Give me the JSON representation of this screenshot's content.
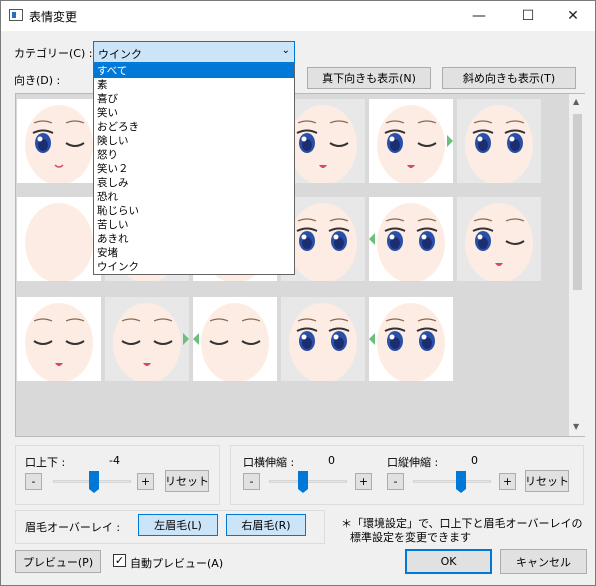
{
  "window": {
    "title": "表情変更",
    "minimize_icon": "minimize-icon",
    "maximize_icon": "maximize-icon",
    "close_icon": "close-icon"
  },
  "category": {
    "label": "カテゴリー(C) :",
    "selected": "ウインク",
    "options": [
      "すべて",
      "素",
      "喜び",
      "笑い",
      "おどろき",
      "険しい",
      "怒り",
      "笑い２",
      "哀しみ",
      "恐れ",
      "恥じらい",
      "苦しい",
      "あきれ",
      "安堵",
      "ウインク"
    ],
    "highlighted_index": 0
  },
  "direction": {
    "label": "向き(D) :",
    "show_down_button": "真下向きも表示(N)",
    "show_diag_button": "斜め向きも表示(T)"
  },
  "grid": {
    "faces": [
      {
        "eyes": "blue-open-left-wink",
        "mouth": "smile"
      },
      {
        "eyes": "hidden",
        "mouth": "none"
      },
      {
        "eyes": "hidden",
        "mouth": "none"
      },
      {
        "eyes": "wink-right",
        "mouth": "tongue"
      },
      {
        "eyes": "blue-open-right-wink-side",
        "mouth": "tongue",
        "arrow": "right"
      },
      {
        "eyes": "side-left",
        "mouth": "none"
      },
      {
        "eyes": "hidden",
        "mouth": "none"
      },
      {
        "eyes": "hidden",
        "mouth": "none"
      },
      {
        "eyes": "side-frown",
        "mouth": "none",
        "arrow": "right"
      },
      {
        "eyes": "blue-open-both",
        "mouth": "none"
      },
      {
        "eyes": "blue-open-side",
        "mouth": "none",
        "arrow": "left"
      },
      {
        "eyes": "blue-open-both-wink",
        "mouth": "tongue"
      },
      {
        "eyes": "closed-wink",
        "mouth": "tongue"
      },
      {
        "eyes": "wink-both",
        "mouth": "open",
        "arrow": "right"
      },
      {
        "eyes": "closed-blue",
        "mouth": "none",
        "arrow": "left"
      },
      {
        "eyes": "blue-open-frown",
        "mouth": "none"
      },
      {
        "eyes": "blue-open-frown-side",
        "mouth": "none",
        "arrow": "left"
      }
    ]
  },
  "sliders": {
    "mouth_updown": {
      "label": "口上下 :",
      "value": "-4",
      "minus": "-",
      "plus": "+",
      "reset": "リセット",
      "position_pct": 46
    },
    "mouth_width": {
      "label": "口横伸縮 :",
      "value": "0",
      "minus": "-",
      "plus": "+",
      "position_pct": 50
    },
    "mouth_height": {
      "label": "口縦伸縮 :",
      "value": "0",
      "minus": "-",
      "plus": "+",
      "reset": "リセット",
      "position_pct": 75
    }
  },
  "brow_overlay": {
    "label": "眉毛オーバーレイ :",
    "left_button": "左眉毛(L)",
    "right_button": "右眉毛(R)"
  },
  "note": {
    "line1": "＊「環境設定」で、口上下と眉毛オーバーレイの",
    "line2": "標準設定を変更できます"
  },
  "footer": {
    "preview_button": "プレビュー(P)",
    "auto_preview_label": "自動プレビュー(A)",
    "auto_preview_checked": "✓",
    "ok_button": "OK",
    "cancel_button": "キャンセル"
  },
  "colors": {
    "accent": "#0078d7",
    "eye_blue": "#2a4fa8",
    "skin": "#fdece3",
    "arrow_green": "#6bbf7a",
    "mouth_pink": "#d24a6a"
  }
}
